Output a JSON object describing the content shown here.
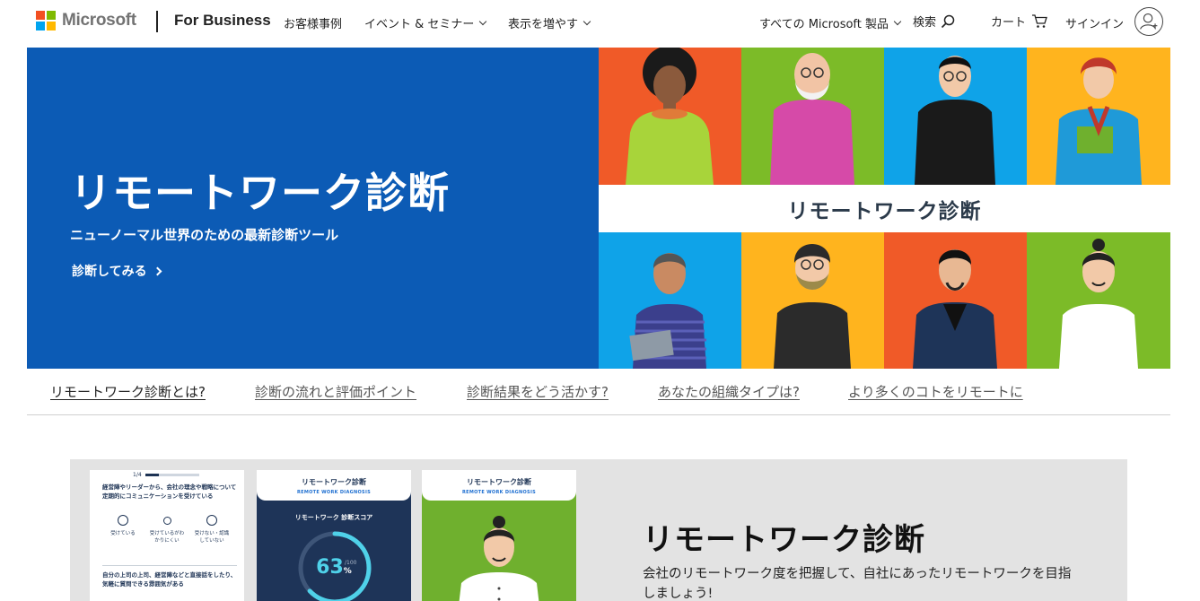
{
  "header": {
    "brand": "Microsoft",
    "section": "For Business",
    "nav": {
      "customers": "お客様事例",
      "events": "イベント & セミナー",
      "more": "表示を増やす"
    },
    "all_products": "すべての Microsoft 製品",
    "search_label": "検索",
    "cart_label": "カート",
    "signin_label": "サインイン",
    "logo_colors": [
      "#f25022",
      "#7fba00",
      "#00a4ef",
      "#ffb900"
    ]
  },
  "hero": {
    "title": "リモートワーク診断",
    "subtitle": "ニューノーマル世界のための最新診断ツール",
    "cta": "診断してみる",
    "image_band_text": "リモートワーク診断",
    "bg_color": "#0c5bb5",
    "tile_colors": [
      "#f05a28",
      "#7cbb28",
      "#0fa3e8",
      "#ffb41e",
      "#0fa3e8",
      "#ffb41e",
      "#f05a28",
      "#7cbb28"
    ]
  },
  "tabs": [
    {
      "label": "リモートワーク診断とは?"
    },
    {
      "label": "診断の流れと評価ポイント"
    },
    {
      "label": "診断結果をどう活かす?"
    },
    {
      "label": "あなたの組織タイプは?"
    },
    {
      "label": "より多くのコトをリモートに"
    }
  ],
  "promo": {
    "title": "リモートワーク診断",
    "description": "会社のリモートワーク度を把握して、自社にあったリモートワークを目指しましょう!",
    "phone1": {
      "progress": "1/4",
      "progress_value": 0.25,
      "question1": "経営陣やリーダーから、会社の理念や戦略について定期的にコミュニケーションを受けている",
      "options": [
        "受けている",
        "受けているがわかりにくい",
        "受けない・認識していない"
      ],
      "question2": "自分の上司の上司、経営陣などと直接話をしたり、気軽に質問できる雰囲気がある"
    },
    "phone2": {
      "title": "リモートワーク診断",
      "subtitle": "REMOTE WORK DIAGNOSIS",
      "score_label": "リモートワーク 診断スコア",
      "score": "63",
      "score_unit": "%",
      "score_max": "/100",
      "score_value": 63
    },
    "phone3": {
      "title": "リモートワーク診断",
      "subtitle": "REMOTE WORK DIAGNOSIS"
    }
  }
}
